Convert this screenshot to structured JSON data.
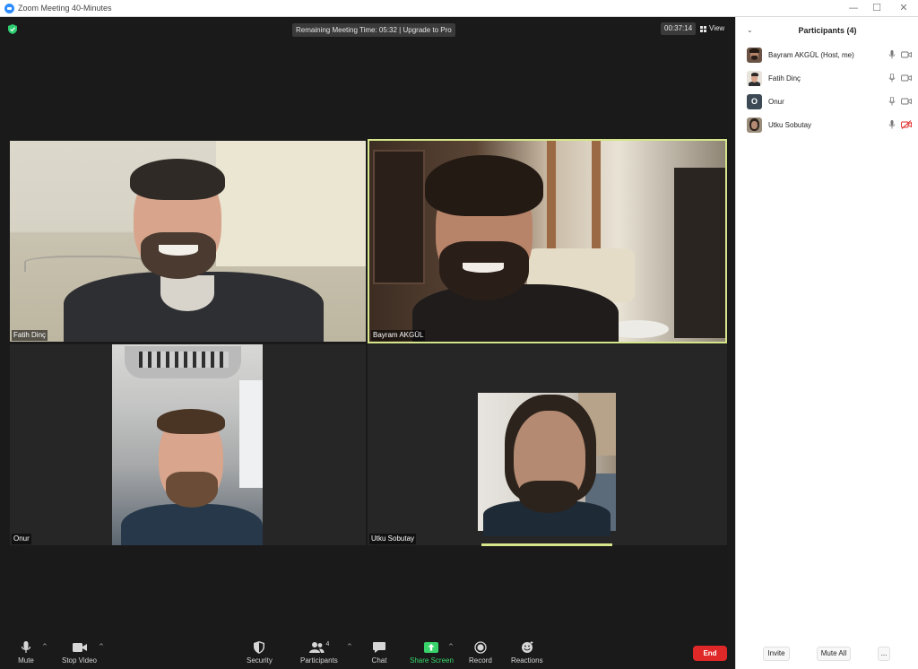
{
  "window": {
    "title": "Zoom Meeting 40-Minutes",
    "min_glyph": "—",
    "max_glyph": "☐",
    "close_glyph": "✕"
  },
  "meeting": {
    "timer_banner": "Remaining Meeting Time: 05:32 | Upgrade to Pro",
    "elapsed": "00:37:14",
    "view_label": "View",
    "colors": {
      "active_speaker": "#d6e68a",
      "encryption": "#2ecc71",
      "end": "#e02828",
      "share": "#38d46b"
    }
  },
  "tiles": [
    {
      "name": "Fatih Dinç"
    },
    {
      "name": "Bayram AKGÜL"
    },
    {
      "name": "Onur"
    },
    {
      "name": "Utku Sobutay"
    }
  ],
  "toolbar": {
    "mute": "Mute",
    "stop_video": "Stop Video",
    "security": "Security",
    "participants": "Participants",
    "participants_count": "4",
    "chat": "Chat",
    "share_screen": "Share Screen",
    "record": "Record",
    "reactions": "Reactions",
    "end": "End",
    "caret": "^"
  },
  "panel": {
    "collapse_glyph": "⌄",
    "title": "Participants (4)",
    "participants": [
      {
        "name": "Bayram AKGÜL (Host, me)",
        "avatar": "photo",
        "mic": "on",
        "video": "on"
      },
      {
        "name": "Fatih Dinç",
        "avatar": "photo",
        "mic": "on",
        "video": "on"
      },
      {
        "name": "Onur",
        "avatar": "O",
        "mic": "on",
        "video": "on"
      },
      {
        "name": "Utku Sobutay",
        "avatar": "photo",
        "mic": "on",
        "video": "off"
      }
    ],
    "invite": "Invite",
    "mute_all": "Mute All",
    "more": "..."
  }
}
